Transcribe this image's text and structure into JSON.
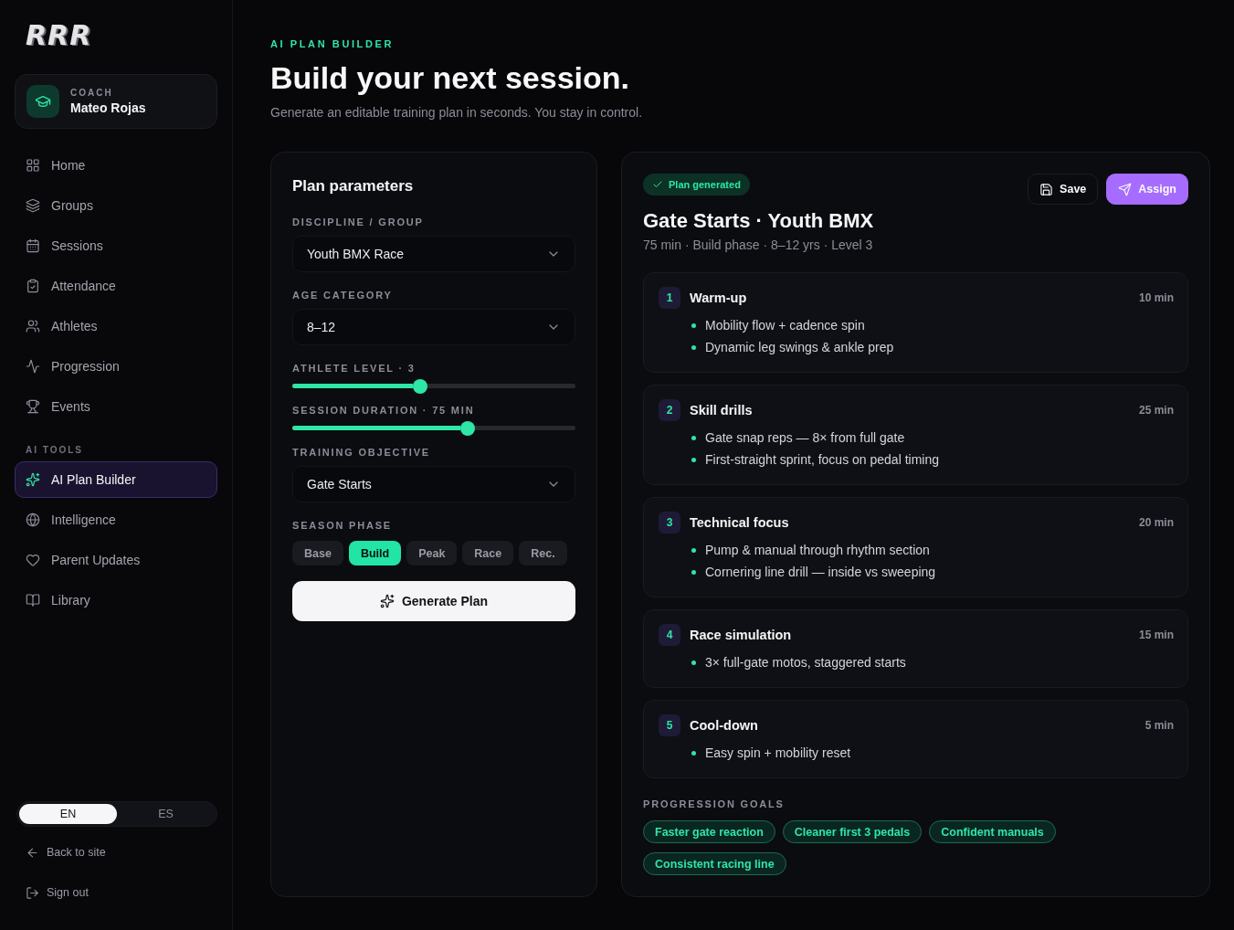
{
  "sidebar": {
    "logo": "RRR",
    "profile": {
      "role": "COACH",
      "name": "Mateo Rojas"
    },
    "nav": [
      {
        "label": "Home",
        "selected": false
      },
      {
        "label": "Groups",
        "selected": false
      },
      {
        "label": "Sessions",
        "selected": false
      },
      {
        "label": "Attendance",
        "selected": false
      },
      {
        "label": "Athletes",
        "selected": false
      },
      {
        "label": "Progression",
        "selected": false
      },
      {
        "label": "Events",
        "selected": false
      }
    ],
    "ai_section": {
      "title": "AI TOOLS",
      "items": [
        {
          "label": "AI Plan Builder",
          "selected": true
        },
        {
          "label": "Intelligence",
          "selected": false
        },
        {
          "label": "Parent Updates",
          "selected": false
        },
        {
          "label": "Library",
          "selected": false
        }
      ]
    },
    "language_toggle": [
      {
        "label": "EN",
        "selected": true
      },
      {
        "label": "ES",
        "selected": false
      }
    ],
    "footer_links": [
      "Back to site",
      "Sign out"
    ]
  },
  "header": {
    "eyebrow": "AI PLAN BUILDER",
    "title": "Build your next session.",
    "subtitle": "Generate an editable training plan in seconds. You stay in control."
  },
  "parameters": {
    "title": "Plan parameters",
    "fields": [
      {
        "kind": "select",
        "label": "DISCIPLINE / GROUP",
        "value": "Youth BMX Race"
      },
      {
        "kind": "select",
        "label": "AGE CATEGORY",
        "value": "8–12"
      },
      {
        "kind": "slider",
        "label": "ATHLETE LEVEL · 3",
        "level": 0.45
      },
      {
        "kind": "slider",
        "label": "SESSION DURATION · 75 MIN",
        "level": 0.62
      },
      {
        "kind": "select",
        "label": "TRAINING OBJECTIVE",
        "value": "Gate Starts"
      },
      {
        "kind": "chips",
        "label": "SEASON PHASE",
        "options": [
          {
            "label": "Base",
            "selected": false
          },
          {
            "label": "Build",
            "selected": true
          },
          {
            "label": "Peak",
            "selected": false
          },
          {
            "label": "Race",
            "selected": false
          },
          {
            "label": "Rec.",
            "selected": false
          }
        ]
      }
    ],
    "button": "Generate Plan"
  },
  "plan": {
    "status": "Plan generated",
    "actions": [
      {
        "kind": "secondary",
        "label": "Save"
      },
      {
        "kind": "primary",
        "label": "Assign"
      }
    ],
    "title": "Gate Starts · Youth BMX",
    "meta": "75 min · Build phase · 8–12 yrs · Level 3",
    "blocks": [
      {
        "number": "1",
        "title": "Warm-up",
        "duration": "10 min",
        "items": [
          "Mobility flow + cadence spin",
          "Dynamic leg swings & ankle prep"
        ]
      },
      {
        "number": "2",
        "title": "Skill drills",
        "duration": "25 min",
        "items": [
          "Gate snap reps — 8× from full gate",
          "First-straight sprint, focus on pedal timing"
        ]
      },
      {
        "number": "3",
        "title": "Technical focus",
        "duration": "20 min",
        "items": [
          "Pump & manual through rhythm section",
          "Cornering line drill — inside vs sweeping"
        ]
      },
      {
        "number": "4",
        "title": "Race simulation",
        "duration": "15 min",
        "items": [
          "3× full-gate motos, staggered starts"
        ]
      },
      {
        "number": "5",
        "title": "Cool-down",
        "duration": "5 min",
        "items": [
          "Easy spin + mobility reset"
        ]
      }
    ],
    "goals_label": "PROGRESSION GOALS",
    "goals": [
      "Faster gate reaction",
      "Cleaner first 3 pedals",
      "Confident manuals",
      "Consistent racing line"
    ]
  }
}
